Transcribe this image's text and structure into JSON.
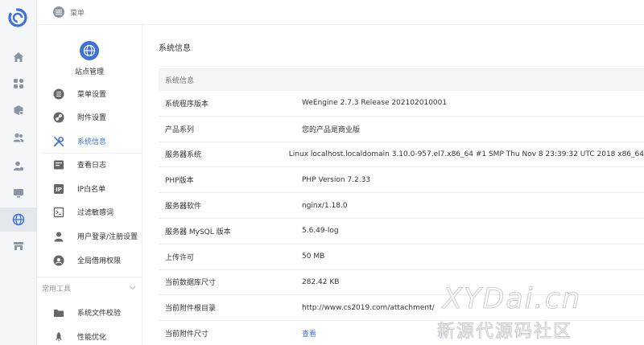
{
  "topbar": {
    "menu_label": "菜单"
  },
  "site": {
    "title": "站点管理"
  },
  "sidebar": {
    "items": [
      {
        "label": "菜单设置",
        "icon": "list-icon"
      },
      {
        "label": "附件设置",
        "icon": "link-icon"
      },
      {
        "label": "系统信息",
        "icon": "wrench-icon",
        "active": true
      },
      {
        "label": "查看日志",
        "icon": "log-icon"
      },
      {
        "label": "IP白名单",
        "icon": "ip-icon"
      },
      {
        "label": "过滤敏感词",
        "icon": "filter-icon"
      },
      {
        "label": "用户登录/注册设置",
        "icon": "user-icon"
      },
      {
        "label": "全局借用权限",
        "icon": "permission-icon"
      }
    ],
    "group_label": "常用工具",
    "tools": [
      {
        "label": "系统文件校验",
        "icon": "folder-icon"
      },
      {
        "label": "性能优化",
        "icon": "rocket-icon"
      }
    ]
  },
  "main": {
    "title": "系统信息",
    "table_header": "系统信息",
    "rows": [
      {
        "key": "系统程序版本",
        "value": "WeEngine 2.7.3 Release 202102010001"
      },
      {
        "key": "产品系列",
        "value": "您的产品是商业版"
      },
      {
        "key": "服务器系统",
        "value": "Linux localhost.localdomain 3.10.0-957.el7.x86_64 #1 SMP Thu Nov 8 23:39:32 UTC 2018 x86_64"
      },
      {
        "key": "PHP版本",
        "value": "PHP Version 7.2.33"
      },
      {
        "key": "服务器软件",
        "value": "nginx/1.18.0"
      },
      {
        "key": "服务器 MySQL 版本",
        "value": "5.6.49-log"
      },
      {
        "key": "上传许可",
        "value": "50 MB"
      },
      {
        "key": "当前数据库尺寸",
        "value": "282.42 KB"
      },
      {
        "key": "当前附件根目录",
        "value": "http://www.cs2019.com/attachment/"
      },
      {
        "key": "当前附件尺寸",
        "value": "查看",
        "link": true
      }
    ]
  },
  "watermark": {
    "line1": "XYDai.cn",
    "line2": "新源代源码社区"
  },
  "colors": {
    "accent": "#3e70d7",
    "rail_bg": "#f5f6f8",
    "icon_gray": "#8a94a3"
  }
}
